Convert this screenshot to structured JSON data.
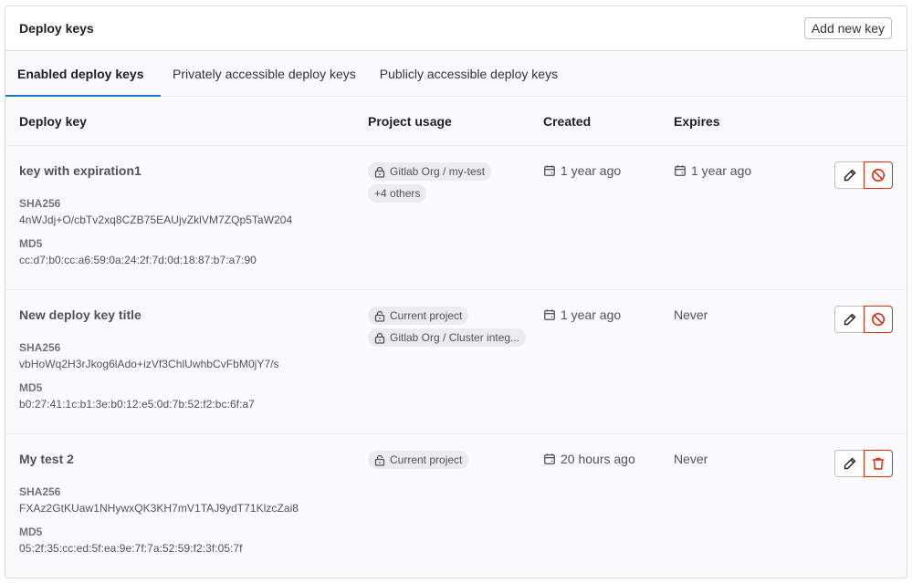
{
  "header": {
    "title": "Deploy keys",
    "add_button": "Add new key"
  },
  "tabs": [
    {
      "label": "Enabled deploy keys",
      "active": true
    },
    {
      "label": "Privately accessible deploy keys",
      "active": false
    },
    {
      "label": "Publicly accessible deploy keys",
      "active": false
    }
  ],
  "columns": {
    "key": "Deploy key",
    "usage": "Project usage",
    "created": "Created",
    "expires": "Expires"
  },
  "colors": {
    "accent": "#1f75cb",
    "danger": "#dd2b0e"
  },
  "rows": [
    {
      "title": "key with expiration1",
      "sha_label": "SHA256",
      "sha": "4nWJdj+O/cbTv2xq8CZB75EAUjvZklVM7ZQp5TaW204",
      "md5_label": "MD5",
      "md5": "cc:d7:b0:cc:a6:59:0a:24:2f:7d:0d:18:87:b7:a7:90",
      "usage": [
        {
          "icon": "lock-icon",
          "label": "Gitlab Org / my-test"
        },
        {
          "icon": "",
          "label": "+4 others"
        }
      ],
      "created": "1 year ago",
      "expires": "1 year ago",
      "expires_has_icon": true,
      "danger_action": "disable-icon"
    },
    {
      "title": "New deploy key title",
      "sha_label": "SHA256",
      "sha": "vbHoWq2H3rJkog6lAdo+izVf3ChlUwhbCvFbM0jY7/s",
      "md5_label": "MD5",
      "md5": "b0:27:41:1c:b1:3e:b0:12:e5:0d:7b:52:f2:bc:6f:a7",
      "usage": [
        {
          "icon": "lock-open-icon",
          "label": "Current project"
        },
        {
          "icon": "lock-icon",
          "label": "Gitlab Org / Cluster integ..."
        }
      ],
      "created": "1 year ago",
      "expires": "Never",
      "expires_has_icon": false,
      "danger_action": "disable-icon"
    },
    {
      "title": "My test 2",
      "sha_label": "SHA256",
      "sha": "FXAz2GtKUaw1NHywxQK3KH7mV1TAJ9ydT71KlzcZai8",
      "md5_label": "MD5",
      "md5": "05:2f:35:cc:ed:5f:ea:9e:7f:7a:52:59:f2:3f:05:7f",
      "usage": [
        {
          "icon": "lock-open-icon",
          "label": "Current project"
        }
      ],
      "created": "20 hours ago",
      "expires": "Never",
      "expires_has_icon": false,
      "danger_action": "trash-icon"
    }
  ]
}
